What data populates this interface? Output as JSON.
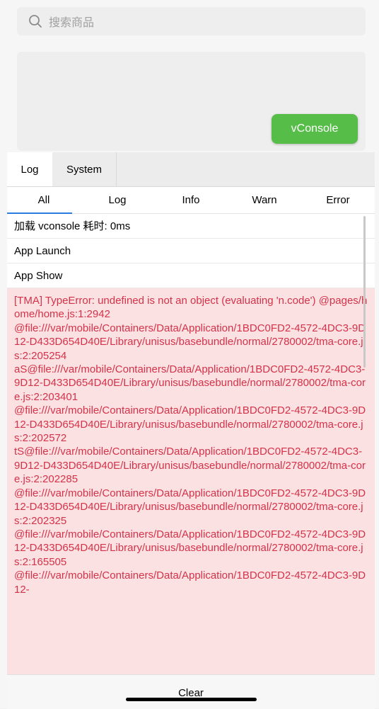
{
  "search": {
    "placeholder": "搜索商品"
  },
  "vconsole_button": {
    "label": "vConsole"
  },
  "top_tabs": [
    {
      "label": "Log"
    },
    {
      "label": "System"
    }
  ],
  "filter_tabs": [
    {
      "label": "All"
    },
    {
      "label": "Log"
    },
    {
      "label": "Info"
    },
    {
      "label": "Warn"
    },
    {
      "label": "Error"
    }
  ],
  "logs": [
    {
      "text": "加载 vconsole 耗时: 0ms"
    },
    {
      "text": "App Launch"
    },
    {
      "text": "App Show"
    }
  ],
  "error_log": {
    "text": "[TMA] TypeError: undefined is not an object (evaluating 'n.code') @pages/home/home.js:1:2942\n@file:///var/mobile/Containers/Data/Application/1BDC0FD2-4572-4DC3-9D12-D433D654D40E/Library/unisus/basebundle/normal/2780002/tma-core.js:2:205254\naS@file:///var/mobile/Containers/Data/Application/1BDC0FD2-4572-4DC3-9D12-D433D654D40E/Library/unisus/basebundle/normal/2780002/tma-core.js:2:203401\n@file:///var/mobile/Containers/Data/Application/1BDC0FD2-4572-4DC3-9D12-D433D654D40E/Library/unisus/basebundle/normal/2780002/tma-core.js:2:202572\ntS@file:///var/mobile/Containers/Data/Application/1BDC0FD2-4572-4DC3-9D12-D433D654D40E/Library/unisus/basebundle/normal/2780002/tma-core.js:2:202285\n@file:///var/mobile/Containers/Data/Application/1BDC0FD2-4572-4DC3-9D12-D433D654D40E/Library/unisus/basebundle/normal/2780002/tma-core.js:2:202325\n@file:///var/mobile/Containers/Data/Application/1BDC0FD2-4572-4DC3-9D12-D433D654D40E/Library/unisus/basebundle/normal/2780002/tma-core.js:2:165505\n@file:///var/mobile/Containers/Data/Application/1BDC0FD2-4572-4DC3-9D12-",
    "color": "#d4324a",
    "background": "#fbe1e1"
  },
  "footer": {
    "clear_label": "Clear"
  },
  "colors": {
    "accent": "#56bd48",
    "tab_indicator": "#2b7be0"
  }
}
